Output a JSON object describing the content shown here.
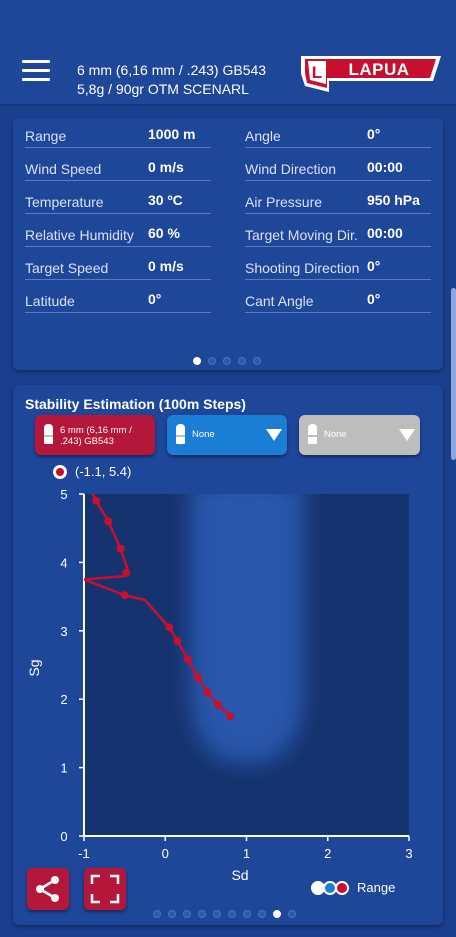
{
  "header": {
    "title_line1": "6 mm (6,16 mm / .243) GB543",
    "title_line2": "5,8g / 90gr OTM SCENARL",
    "logo_text": "LAPUA",
    "logo_letter": "L"
  },
  "conditions": {
    "left": [
      {
        "label": "Range",
        "value": "1000 m"
      },
      {
        "label": "Wind Speed",
        "value": "0 m/s"
      },
      {
        "label": "Temperature",
        "value": "30 ºC"
      },
      {
        "label": "Relative Humidity",
        "value": "60 %"
      },
      {
        "label": "Target Speed",
        "value": "0 m/s"
      },
      {
        "label": "Latitude",
        "value": "0°"
      }
    ],
    "right": [
      {
        "label": "Angle",
        "value": "0°"
      },
      {
        "label": "Wind Direction",
        "value": "00:00"
      },
      {
        "label": "Air Pressure",
        "value": "950 hPa"
      },
      {
        "label": "Target Moving Dir.",
        "value": "00:00"
      },
      {
        "label": "Shooting Direction",
        "value": "0°"
      },
      {
        "label": "Cant Angle",
        "value": "0°"
      }
    ],
    "page_count": 5,
    "active_page": 1
  },
  "stability": {
    "title": "Stability Estimation (100m Steps)",
    "selectors": [
      {
        "label": "6 mm (6,16 mm / .243) GB543",
        "color": "#b5173a",
        "has_dropdown": false
      },
      {
        "label": "None",
        "color": "#1a7fd4",
        "has_dropdown": true
      },
      {
        "label": "None",
        "color": "#bdbdbd",
        "has_dropdown": true
      }
    ],
    "coordinate_readout": "(-1.1, 5.4)",
    "legend_label": "Range",
    "page_count": 10,
    "active_page": 9
  },
  "colors": {
    "background": "#1b3f8f",
    "panel": "#1e4699",
    "accent_red": "#c8102e",
    "plot_bg": "#15336f"
  },
  "chart_data": {
    "type": "line",
    "xlabel": "Sd",
    "ylabel": "Sg",
    "xlim": [
      -1,
      3
    ],
    "ylim": [
      0,
      5
    ],
    "xticks": [
      "-1",
      "0",
      "1",
      "2",
      "3"
    ],
    "yticks": [
      "0",
      "1",
      "2",
      "3",
      "4",
      "5"
    ],
    "series": [
      {
        "color": "#c8102e",
        "x": [
          -1.0,
          -0.85,
          -0.7,
          -0.55,
          -0.45,
          -0.5,
          -1.0,
          -0.5,
          -0.25,
          0.05,
          0.15,
          0.28,
          0.4,
          0.52,
          0.65,
          0.8
        ],
        "y": [
          5.25,
          4.9,
          4.6,
          4.2,
          3.85,
          3.8,
          3.75,
          3.52,
          3.45,
          3.05,
          2.85,
          2.58,
          2.32,
          2.1,
          1.92,
          1.75
        ],
        "markers_x": [
          -0.85,
          -0.7,
          -0.55,
          -0.48,
          -0.5,
          0.05,
          0.15,
          0.28,
          0.4,
          0.52,
          0.65,
          0.8
        ],
        "markers_y": [
          4.9,
          4.6,
          4.2,
          3.85,
          3.52,
          3.05,
          2.85,
          2.58,
          2.32,
          2.1,
          1.92,
          1.75
        ]
      }
    ],
    "grid": false
  }
}
